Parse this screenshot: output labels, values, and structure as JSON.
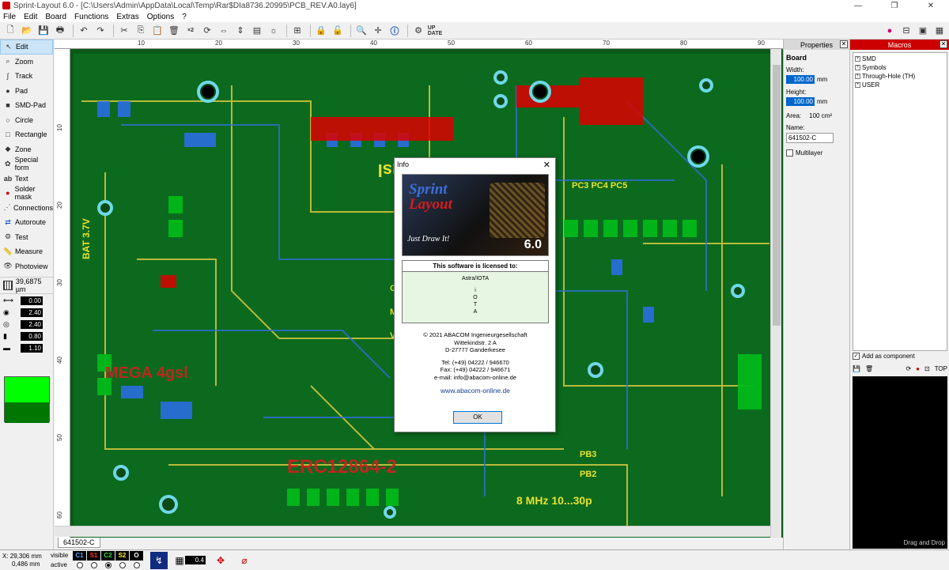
{
  "window": {
    "title": "Sprint-Layout 6.0 - [C:\\Users\\Admin\\AppData\\Local\\Temp\\Rar$DIa8736.20995\\PCB_REV.A0.lay6]",
    "minimize": "—",
    "maximize": "❐",
    "close": "✕"
  },
  "menu": [
    "File",
    "Edit",
    "Board",
    "Functions",
    "Extras",
    "Options",
    "?"
  ],
  "toolbar": {
    "x2_label": "×2",
    "update_label": "UP DATE"
  },
  "tools": [
    {
      "label": "Edit",
      "icon": "cursor-icon",
      "glyph": "↖"
    },
    {
      "label": "Zoom",
      "icon": "zoom-icon",
      "glyph": "⌕"
    },
    {
      "label": "Track",
      "icon": "track-icon",
      "glyph": "∫"
    },
    {
      "label": "Pad",
      "icon": "pad-icon",
      "glyph": "●"
    },
    {
      "label": "SMD-Pad",
      "icon": "smd-pad-icon",
      "glyph": "■"
    },
    {
      "label": "Circle",
      "icon": "circle-icon",
      "glyph": "○"
    },
    {
      "label": "Rectangle",
      "icon": "rectangle-icon",
      "glyph": "□"
    },
    {
      "label": "Zone",
      "icon": "zone-icon",
      "glyph": "◆"
    },
    {
      "label": "Special form",
      "icon": "special-form-icon",
      "glyph": "✿"
    },
    {
      "label": "Text",
      "icon": "text-icon",
      "glyph": "ab"
    },
    {
      "label": "Solder mask",
      "icon": "solder-mask-icon",
      "glyph": "●"
    },
    {
      "label": "Connections",
      "icon": "connections-icon",
      "glyph": "⋰"
    },
    {
      "label": "Autoroute",
      "icon": "autoroute-icon",
      "glyph": "⇄"
    },
    {
      "label": "Test",
      "icon": "test-icon",
      "glyph": "⚙"
    },
    {
      "label": "Measure",
      "icon": "measure-icon",
      "glyph": "📏"
    },
    {
      "label": "Photoview",
      "icon": "photoview-icon",
      "glyph": "👁"
    }
  ],
  "grid_value": "39,6875 µm",
  "values": [
    "0.00",
    "2.40",
    "2.40",
    "0.80",
    "1.10"
  ],
  "ruler": {
    "h": [
      "10",
      "20",
      "30",
      "40",
      "50",
      "60",
      "70",
      "80",
      "90"
    ],
    "v": [
      "10",
      "20",
      "30",
      "40",
      "50",
      "60"
    ]
  },
  "layer_tab": "641502-C",
  "properties": {
    "header": "Properties",
    "section": "Board",
    "width_label": "Width:",
    "width_value": "100.00",
    "height_label": "Height:",
    "height_value": "100.00",
    "unit": "mm",
    "area_label": "Area:",
    "area_value": "100 cm²",
    "name_label": "Name:",
    "name_value": "641502-C",
    "multilayer_label": "Multilayer"
  },
  "macros": {
    "header": "Macros",
    "tree": [
      "SMD",
      "Symbols",
      "Through-Hole (TH)",
      "USER"
    ],
    "add_component": "Add as component",
    "top_label": "TOP",
    "drag_drop": "Drag and Drop"
  },
  "status": {
    "x": "X:  29,306 mm",
    "y": "0,486 mm",
    "visible": "visible",
    "active": "active",
    "layers": [
      {
        "name": "C1",
        "color": "#4da6ff"
      },
      {
        "name": "S1",
        "color": "#ff3333"
      },
      {
        "name": "C2",
        "color": "#33dd33"
      },
      {
        "name": "S2",
        "color": "#ffee33"
      },
      {
        "name": "O",
        "color": "#ffffff"
      }
    ],
    "active_index": 2,
    "zoom_value": "0.4"
  },
  "dialog": {
    "title": "Info",
    "close": "✕",
    "splash_line1": "Sprint",
    "splash_line2": "Layout",
    "splash_tagline": "Just Draw It!",
    "splash_version": "6.0",
    "license_header": "This software is licensed to:",
    "license_name": "Astra/IOTA",
    "license_lines": [
      "i",
      "O",
      "T",
      "A"
    ],
    "copyright": "© 2021 ABACOM Ingenieurgesellschaft",
    "street": "Wittekindstr. 2 A",
    "city": "D-27777 Ganderkesee",
    "tel": "Tel: (+49) 04222 / 946670",
    "fax": "Fax: (+49) 04222 / 946671",
    "email": "e-mail: info@abacom-online.de",
    "url": "www.abacom-online.de",
    "ok": "OK"
  }
}
